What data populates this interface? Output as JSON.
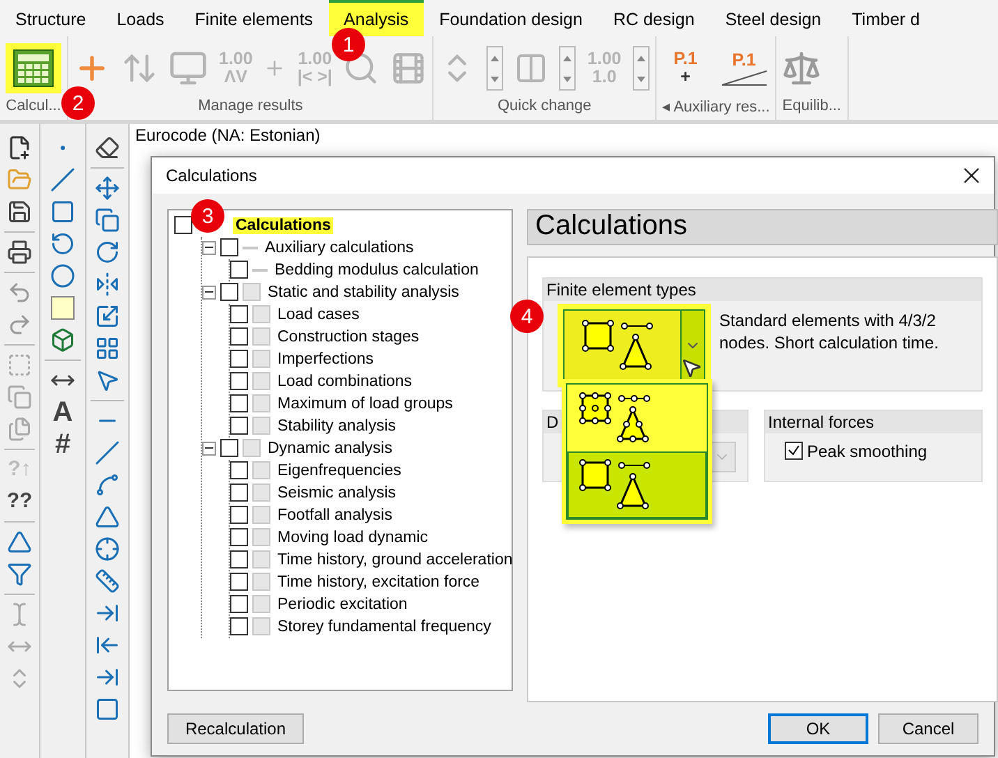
{
  "tabs": [
    {
      "label": "Structure",
      "selected": false
    },
    {
      "label": "Loads",
      "selected": false
    },
    {
      "label": "Finite elements",
      "selected": false
    },
    {
      "label": "Analysis",
      "selected": true
    },
    {
      "label": "Foundation design",
      "selected": false
    },
    {
      "label": "RC design",
      "selected": false
    },
    {
      "label": "Steel design",
      "selected": false
    },
    {
      "label": "Timber d",
      "selected": false
    }
  ],
  "ribbon": {
    "groups": [
      {
        "label": "Calcul...",
        "buttons": [
          {
            "kind": "calc",
            "highlighted": true
          }
        ]
      },
      {
        "label": "Manage results",
        "buttons": [
          {
            "kind": "add"
          },
          {
            "kind": "sort"
          },
          {
            "kind": "monitor"
          },
          {
            "kind": "text",
            "lines": [
              "1.00",
              "ΛV"
            ]
          },
          {
            "kind": "plus"
          },
          {
            "kind": "text",
            "lines": [
              "1.00",
              "|< >|"
            ]
          },
          {
            "kind": "search"
          },
          {
            "kind": "film"
          }
        ]
      },
      {
        "label": "Quick change",
        "buttons": [
          {
            "kind": "updown"
          },
          {
            "kind": "spin"
          },
          {
            "kind": "step"
          },
          {
            "kind": "spin"
          },
          {
            "kind": "text",
            "lines": [
              "1.00",
              "1.0"
            ]
          },
          {
            "kind": "spin"
          }
        ]
      },
      {
        "label": "Auxiliary res...",
        "arrow": "◂",
        "buttons": [
          {
            "kind": "accent",
            "lines": [
              "P.1",
              "+"
            ]
          },
          {
            "kind": "accent-slash",
            "lines": [
              "P.1"
            ]
          }
        ]
      },
      {
        "label": "Equilib...",
        "buttons": [
          {
            "kind": "balance"
          }
        ]
      }
    ]
  },
  "toolbar_glyphs": [
    "?↑",
    "??",
    "A",
    "#"
  ],
  "canvas": {
    "code": "Eurocode (NA: Estonian)"
  },
  "dialog": {
    "title": "Calculations",
    "tree": {
      "label": "Calculations",
      "highlighted": true,
      "checked": false,
      "children": [
        {
          "label": "Auxiliary calculations",
          "checked": false,
          "expanded": true,
          "kind": "dash",
          "children": [
            {
              "label": "Bedding modulus calculation",
              "checked": false,
              "kind": "dash"
            }
          ]
        },
        {
          "label": "Static and stability analysis",
          "checked": false,
          "expanded": true,
          "kind": "box",
          "children": [
            {
              "label": "Load cases",
              "checked": false,
              "kind": "box"
            },
            {
              "label": "Construction stages",
              "checked": false,
              "kind": "box"
            },
            {
              "label": "Imperfections",
              "checked": false,
              "kind": "box"
            },
            {
              "label": "Load combinations",
              "checked": false,
              "kind": "box"
            },
            {
              "label": "Maximum of load groups",
              "checked": false,
              "kind": "box"
            },
            {
              "label": "Stability analysis",
              "checked": false,
              "kind": "box"
            }
          ]
        },
        {
          "label": "Dynamic analysis",
          "checked": false,
          "expanded": true,
          "kind": "box",
          "children": [
            {
              "label": "Eigenfrequencies",
              "checked": false,
              "kind": "box"
            },
            {
              "label": "Seismic analysis",
              "checked": false,
              "kind": "box"
            },
            {
              "label": "Footfall analysis",
              "checked": false,
              "kind": "box"
            },
            {
              "label": "Moving load dynamic",
              "checked": false,
              "kind": "box"
            },
            {
              "label": "Time history, ground acceleration",
              "checked": false,
              "kind": "box"
            },
            {
              "label": "Time history, excitation force",
              "checked": false,
              "kind": "box"
            },
            {
              "label": "Periodic excitation",
              "checked": false,
              "kind": "box"
            },
            {
              "label": "Storey fundamental frequency",
              "checked": false,
              "kind": "box"
            }
          ]
        }
      ]
    },
    "heading": "Calculations",
    "fe_types": {
      "label": "Finite element types",
      "description": "Standard elements with 4/3/2 nodes. Short calculation time.",
      "open": true,
      "options": [
        {
          "kind": "higher",
          "selected": false
        },
        {
          "kind": "standard",
          "selected": true
        }
      ]
    },
    "second_group": {
      "label": "D",
      "disabled": true
    },
    "internal_forces": {
      "label": "Internal forces",
      "option": {
        "label": "Peak smoothing",
        "checked": true
      }
    },
    "buttons": [
      {
        "label": "Recalculation",
        "default": false
      },
      {
        "label": "OK",
        "default": true
      },
      {
        "label": "Cancel",
        "default": false
      }
    ]
  },
  "badges": [
    "1",
    "2",
    "3",
    "4"
  ]
}
